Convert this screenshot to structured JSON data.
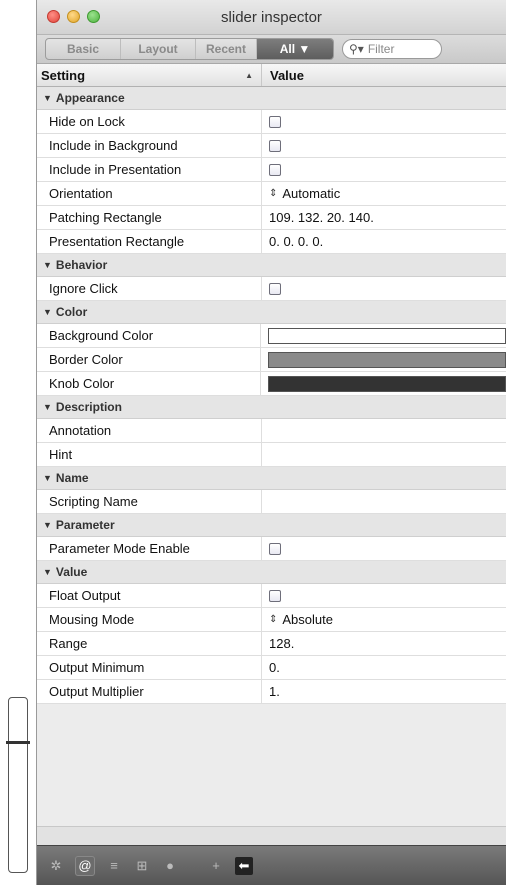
{
  "window": {
    "title": "slider inspector"
  },
  "tabs": [
    {
      "label": "Basic",
      "active": false
    },
    {
      "label": "Layout",
      "active": false
    },
    {
      "label": "Recent",
      "active": false
    },
    {
      "label": "All ▼",
      "active": true
    }
  ],
  "filter": {
    "placeholder": "Filter",
    "icon": "search-icon"
  },
  "columns": {
    "setting": "Setting",
    "value": "Value",
    "sort_icon": "sort-up-arrow"
  },
  "sections": [
    {
      "title": "Appearance",
      "rows": [
        {
          "setting": "Hide on Lock",
          "type": "checkbox",
          "checked": false
        },
        {
          "setting": "Include in Background",
          "type": "checkbox",
          "checked": false
        },
        {
          "setting": "Include in Presentation",
          "type": "checkbox",
          "checked": false
        },
        {
          "setting": "Orientation",
          "type": "menu",
          "value": "Automatic"
        },
        {
          "setting": "Patching Rectangle",
          "type": "text",
          "value": "109. 132. 20. 140."
        },
        {
          "setting": "Presentation Rectangle",
          "type": "text",
          "value": "0. 0. 0. 0."
        }
      ]
    },
    {
      "title": "Behavior",
      "rows": [
        {
          "setting": "Ignore Click",
          "type": "checkbox",
          "checked": false
        }
      ]
    },
    {
      "title": "Color",
      "rows": [
        {
          "setting": "Background Color",
          "type": "color",
          "color": "#ffffff"
        },
        {
          "setting": "Border Color",
          "type": "color",
          "color": "#8a8a8a"
        },
        {
          "setting": "Knob Color",
          "type": "color",
          "color": "#333333"
        }
      ]
    },
    {
      "title": "Description",
      "rows": [
        {
          "setting": "Annotation",
          "type": "text",
          "value": ""
        },
        {
          "setting": "Hint",
          "type": "text",
          "value": ""
        }
      ]
    },
    {
      "title": "Name",
      "rows": [
        {
          "setting": "Scripting Name",
          "type": "text",
          "value": ""
        }
      ]
    },
    {
      "title": "Parameter",
      "rows": [
        {
          "setting": "Parameter Mode Enable",
          "type": "checkbox",
          "checked": false
        }
      ]
    },
    {
      "title": "Value",
      "rows": [
        {
          "setting": "Float Output",
          "type": "checkbox",
          "checked": false
        },
        {
          "setting": "Mousing Mode",
          "type": "menu",
          "value": "Absolute"
        },
        {
          "setting": "Range",
          "type": "text",
          "value": "128."
        },
        {
          "setting": "Output Minimum",
          "type": "text",
          "value": "0."
        },
        {
          "setting": "Output Multiplier",
          "type": "text",
          "value": "1."
        }
      ]
    }
  ],
  "toolbar": {
    "items": [
      {
        "icon": "gear-icon",
        "glyph": "✲"
      },
      {
        "icon": "at-icon",
        "glyph": "@"
      },
      {
        "icon": "list-icon",
        "glyph": "≡"
      },
      {
        "icon": "grid-icon",
        "glyph": "⊞"
      },
      {
        "icon": "circle-icon",
        "glyph": "●"
      },
      {
        "icon": "plus-icon",
        "glyph": "+"
      },
      {
        "icon": "arrow-left-icon",
        "glyph": "⬅"
      }
    ]
  },
  "slider": {
    "value_fraction": 0.75
  }
}
